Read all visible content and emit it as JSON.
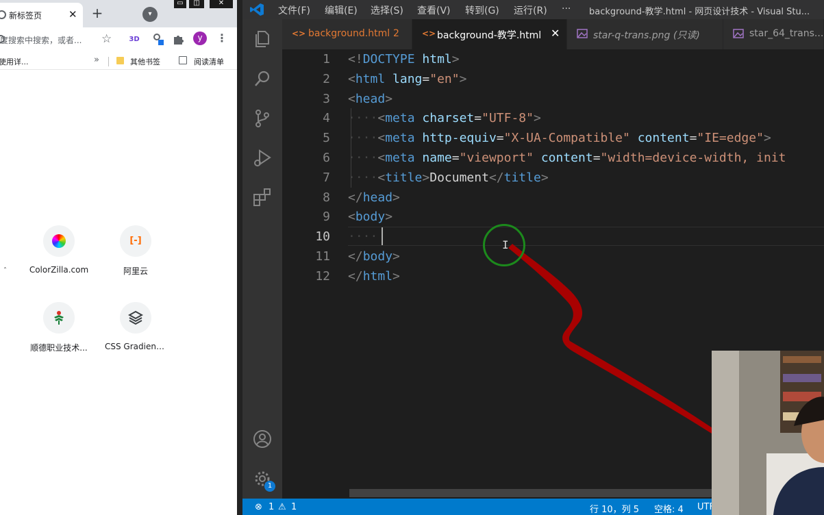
{
  "chrome": {
    "tab_title": "新标签页",
    "tab_close": "✕",
    "new_tab": "+",
    "omnibox_text": "度搜索中搜索，或者...",
    "bookmarks": {
      "left_item": "使用详...",
      "chevron": "»",
      "other": "其他书签",
      "reading_list": "阅读清单"
    },
    "avatar_letter": "y",
    "shortcuts": [
      {
        "label": "ColorZilla.com",
        "icon": "colorzilla-icon"
      },
      {
        "label": "阿里云",
        "icon": "aliyun-icon"
      },
      {
        "label": "顺德职业技术...",
        "icon": "shunde-icon"
      },
      {
        "label": "CSS Gradient ...",
        "icon": "css-gradient-icon"
      }
    ]
  },
  "vscode": {
    "menu": [
      "文件(F)",
      "编辑(E)",
      "选择(S)",
      "查看(V)",
      "转到(G)",
      "运行(R)",
      "···"
    ],
    "window_title": "background-教学.html - 网页设计技术 - Visual Stu...",
    "tabs": [
      {
        "label": "background.html",
        "suffix": "2",
        "icon": "<>",
        "active": false
      },
      {
        "label": "background-教学.html",
        "icon": "<>",
        "active": true
      },
      {
        "label": "star-q-trans.png (只读)",
        "icon": "image-icon",
        "active": false
      },
      {
        "label": "star_64_trans...",
        "icon": "image-icon",
        "active": false
      }
    ],
    "line_numbers": [
      "1",
      "2",
      "3",
      "4",
      "5",
      "6",
      "7",
      "8",
      "9",
      "10",
      "11",
      "12"
    ],
    "status": {
      "problems_errors": "1",
      "problems_warnings": "1",
      "cursor_pos": "行 10，列 5",
      "spaces": "空格: 4",
      "encoding": "UTF"
    },
    "settings_badge": "1"
  },
  "colors": {
    "accent": "#007acc",
    "tag": "#569cd6",
    "attr": "#9cdcfe",
    "string": "#ce9178",
    "cursor_ring": "#1c8a1c",
    "pen": "#c00000"
  }
}
